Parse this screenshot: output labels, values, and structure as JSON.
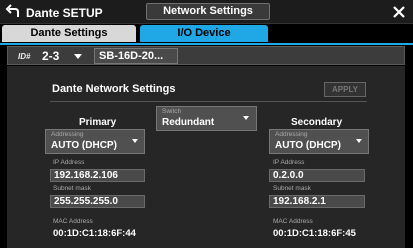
{
  "app": {
    "title": "Dante SETUP",
    "window_title": "Network Settings"
  },
  "tabs": [
    {
      "label": "Dante Settings"
    },
    {
      "label": "I/O Device"
    }
  ],
  "device": {
    "id_label": "ID#",
    "id_value": "2-3",
    "name": "SB-16D-20..."
  },
  "section": {
    "title": "Dante Network Settings",
    "apply_label": "APPLY"
  },
  "switch": {
    "label": "Switch",
    "value": "Redundant"
  },
  "primary": {
    "title": "Primary",
    "addressing_label": "Addressing",
    "addressing_value": "AUTO (DHCP)",
    "ip_label": "IP Address",
    "ip_value": "192.168.2.106",
    "subnet_label": "Subnet mask",
    "subnet_value": "255.255.255.0",
    "mac_label": "MAC Address",
    "mac_value": "00:1D:C1:18:6F:44"
  },
  "secondary": {
    "title": "Secondary",
    "addressing_label": "Addressing",
    "addressing_value": "AUTO (DHCP)",
    "ip_label": "IP Address",
    "ip_value": "0.2.0.0",
    "subnet_label": "Subnet mask",
    "subnet_value": "192.168.2.1",
    "mac_label": "MAC Address",
    "mac_value": "00:1D:C1:18:6F:45"
  },
  "icons": {
    "back": "back-arrow-icon",
    "close": "close-icon"
  },
  "colors": {
    "accent": "#1fa7e6",
    "tab_inactive": "#d8d8d8",
    "panel": "#262626"
  }
}
